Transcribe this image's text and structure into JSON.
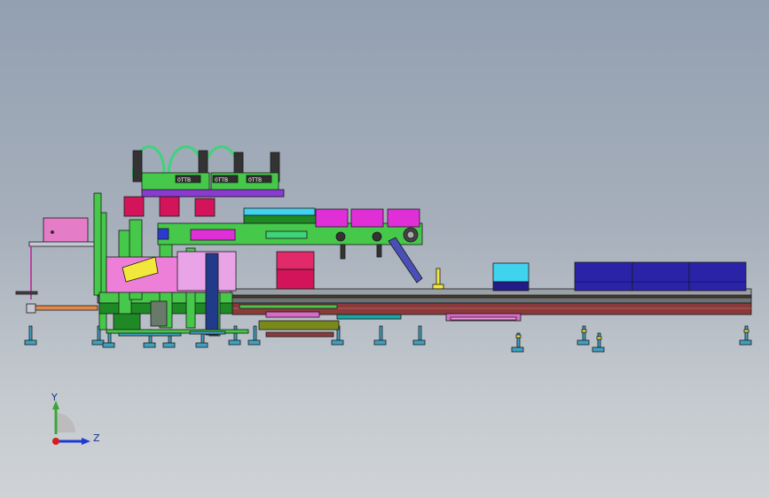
{
  "viewport": {
    "background_top": "#93a0b1",
    "background_bottom": "#cfd3d7",
    "model": {
      "colors": {
        "frame_green": "#46c84a",
        "frame_dark_green": "#1f8a25",
        "outline": "#1a1a1a",
        "magenta": "#e12fd8",
        "pink": "#ee7fd9",
        "crimson": "#d4145a",
        "cyan": "#3fd3ee",
        "navy": "#221c8a",
        "rail_brown": "#8a3a3a",
        "rail_gray": "#8f9599",
        "yellow": "#f2e83b",
        "blue": "#2b3bd0",
        "teal": "#1aa5a5",
        "olive": "#7a8a1a",
        "orange": "#e38a4a"
      },
      "nameplate_text": [
        "0TTB",
        "0TTB",
        "0TTB"
      ]
    },
    "triad": {
      "y_label": "Y",
      "z_label": "Z",
      "y_color": "#3aa63a",
      "z_color": "#1f3ad0",
      "x_color": "#d01f1f"
    }
  }
}
